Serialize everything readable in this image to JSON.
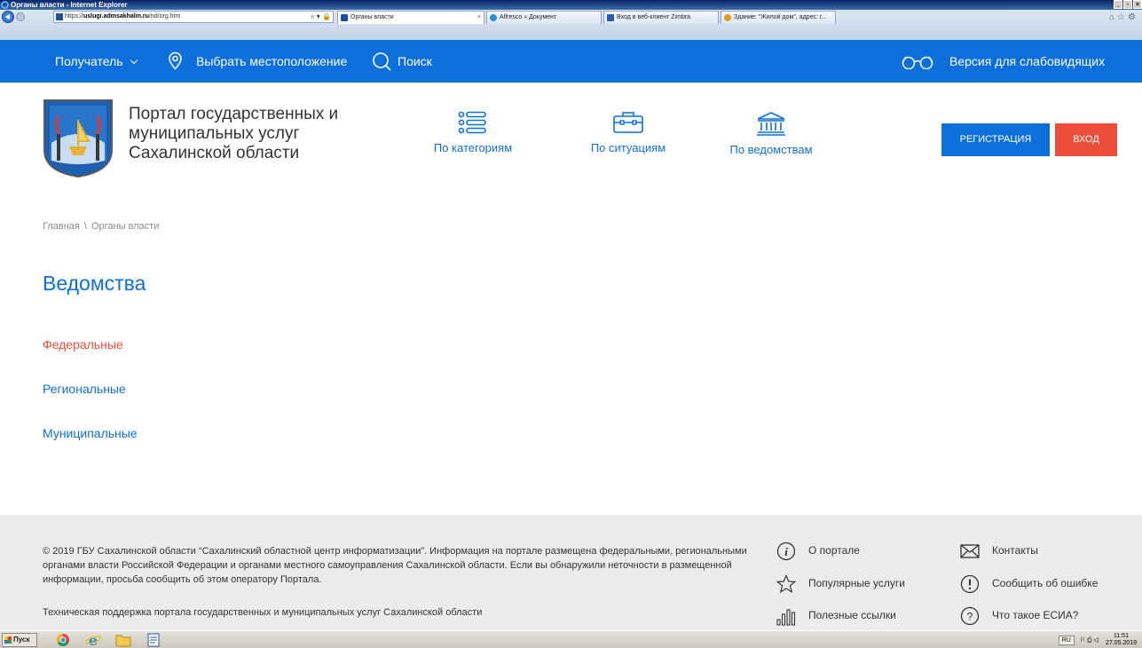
{
  "browser": {
    "window_title": "Органы власти - Internet Explorer",
    "address_prefix": "https://",
    "address_host": "uslugi.admsakhalin.ru",
    "address_path": "/nd/org.htm",
    "tabs": [
      {
        "label": "Органы власти",
        "icon_color": "#1f4f9f",
        "active": true
      },
      {
        "label": "Alfresco » Документ",
        "icon_color": "#2b8fd0",
        "active": false
      },
      {
        "label": "Вход в веб-клиент Zimbra",
        "icon_color": "#2a5db0",
        "active": false
      },
      {
        "label": "Здание: \"Жилой дом\", адрес: г...",
        "icon_color": "#e0a020",
        "active": false
      }
    ]
  },
  "topbar": {
    "recipient_label": "Получатель",
    "location_label": "Выбрать местоположение",
    "search_label": "Поиск",
    "accessibility_label": "Версия для слабовидящих"
  },
  "header": {
    "title_line1": "Портал государственных и",
    "title_line2": "муниципальных услуг",
    "title_line3": "Сахалинской области",
    "categories": [
      {
        "label": "По категориям",
        "icon": "list-icon"
      },
      {
        "label": "По ситуациям",
        "icon": "briefcase-icon"
      },
      {
        "label": "По ведомствам",
        "icon": "building-icon"
      }
    ],
    "register_label": "РЕГИСТРАЦИЯ",
    "login_label": "ВХОД"
  },
  "breadcrumb": {
    "home": "Главная",
    "separator": "\\",
    "current": "Органы власти"
  },
  "main": {
    "title": "Ведомства",
    "links": [
      {
        "label": "Федеральные",
        "active": true
      },
      {
        "label": "Региональные",
        "active": false
      },
      {
        "label": "Муниципальные",
        "active": false
      }
    ]
  },
  "footer": {
    "copyright": "© 2019 ГБУ Сахалинской области “Сахалинский областной центр информатизации”. Информация на портале размещена федеральными, региональными органами власти Российской Федерации и органами местного самоуправления Сахалинской области. Если вы обнаружили неточности в размещенной информации, просьба сообщить об этом оператору Портала.",
    "support": "Техническая поддержка портала государственных и муниципальных услуг Сахалинской области",
    "links": [
      {
        "label": "О портале",
        "icon": "info-icon"
      },
      {
        "label": "Контакты",
        "icon": "envelope-icon"
      },
      {
        "label": "Популярные услуги",
        "icon": "star-icon"
      },
      {
        "label": "Сообщить об ошибке",
        "icon": "exclamation-icon"
      },
      {
        "label": "Полезные ссылки",
        "icon": "bar-chart-icon"
      },
      {
        "label": "Что такое ЕСИА?",
        "icon": "question-icon"
      }
    ]
  },
  "taskbar": {
    "start_label": "Пуск",
    "language": "RU",
    "time": "11:51",
    "date": "27.05.2019"
  },
  "colors": {
    "brand_blue": "#0d6fdc",
    "accent_red": "#ef4d3c",
    "footer_bg": "#e9ebed"
  }
}
